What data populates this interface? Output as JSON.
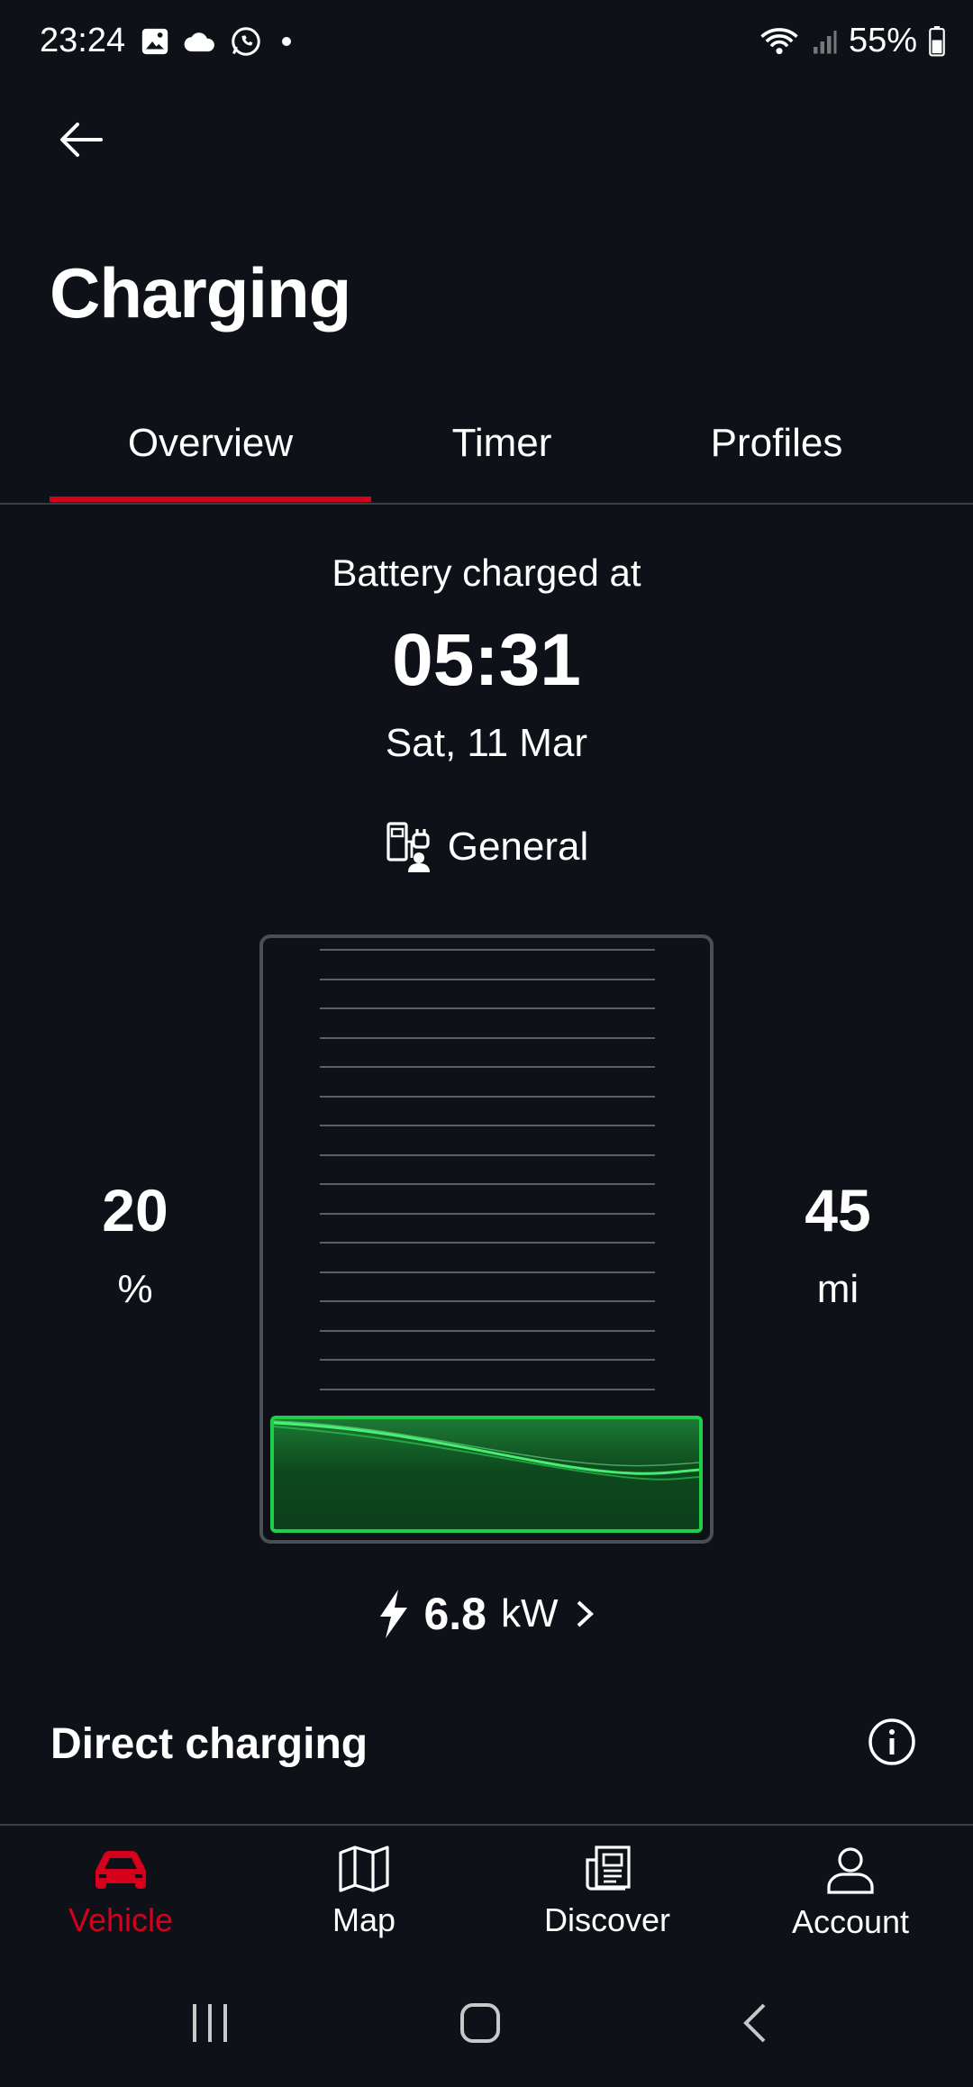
{
  "status_bar": {
    "time": "23:24",
    "battery": "55%"
  },
  "header": {
    "title": "Charging"
  },
  "tabs": [
    {
      "label": "Overview",
      "active": true
    },
    {
      "label": "Timer",
      "active": false
    },
    {
      "label": "Profiles",
      "active": false
    }
  ],
  "overview": {
    "battery_label": "Battery charged at",
    "charge_time": "05:31",
    "charge_date": "Sat, 11 Mar",
    "profile_name": "General",
    "state_of_charge": {
      "value": "20",
      "unit": "%",
      "fill_fraction": 0.2
    },
    "range": {
      "value": "45",
      "unit": "mi"
    },
    "power": {
      "value": "6.8",
      "unit": "kW"
    }
  },
  "section": {
    "direct_charging": "Direct charging"
  },
  "bottom_nav": [
    {
      "label": "Vehicle",
      "active": true
    },
    {
      "label": "Map",
      "active": false
    },
    {
      "label": "Discover",
      "active": false
    },
    {
      "label": "Account",
      "active": false
    }
  ],
  "colors": {
    "accent": "#d5001c",
    "charge_green": "#1fcf4a",
    "background": "#0e1218"
  }
}
